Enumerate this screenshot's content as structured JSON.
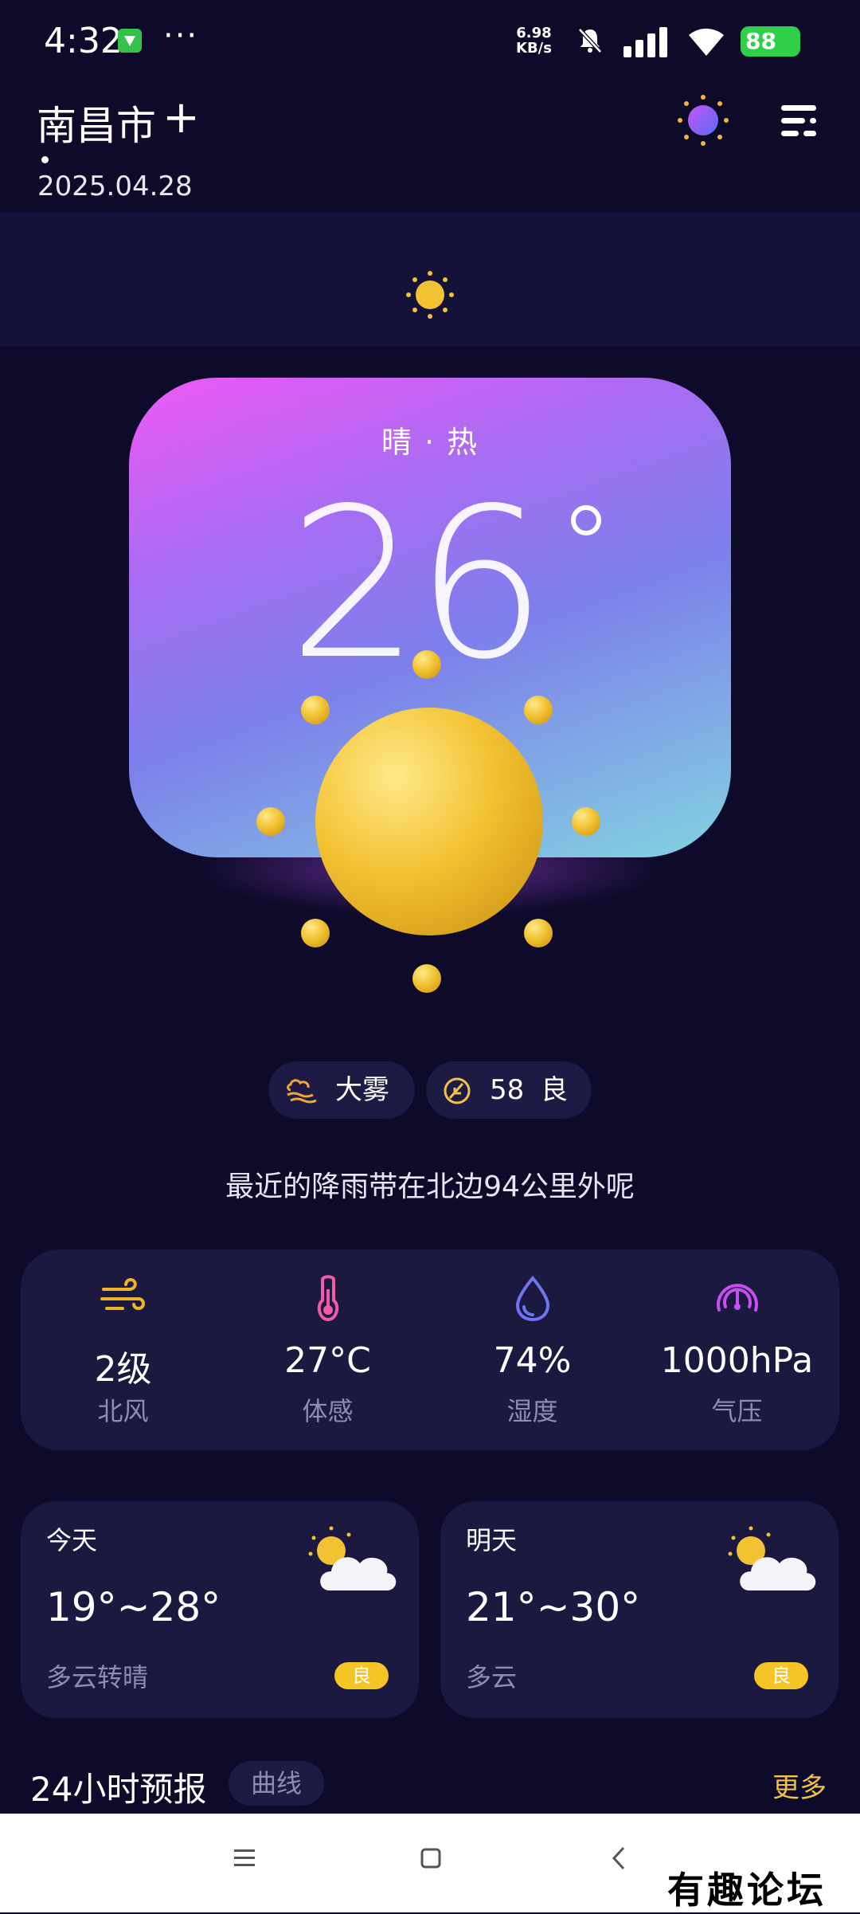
{
  "status_bar": {
    "time": "4:32",
    "more": "···",
    "net_speed_value": "6.98",
    "net_speed_unit": "KB/s",
    "battery": "88"
  },
  "header": {
    "city": "南昌市",
    "add_symbol": "+",
    "date": "2025.04.28"
  },
  "hero": {
    "condition": "晴 · 热",
    "temperature": "26"
  },
  "chips": {
    "weather_tag": "大雾",
    "aqi_value": "58",
    "aqi_level": "良"
  },
  "rain_note": "最近的降雨带在北边94公里外呢",
  "details": [
    {
      "icon": "wind-icon",
      "value": "2级",
      "label": "北风"
    },
    {
      "icon": "thermometer-icon",
      "value": "27°C",
      "label": "体感"
    },
    {
      "icon": "humidity-icon",
      "value": "74%",
      "label": "湿度"
    },
    {
      "icon": "pressure-gauge-icon",
      "value": "1000hPa",
      "label": "气压"
    }
  ],
  "days": [
    {
      "name": "今天",
      "range": "19°~28°",
      "desc": "多云转晴",
      "aqi": "良"
    },
    {
      "name": "明天",
      "range": "21°~30°",
      "desc": "多云",
      "aqi": "良"
    }
  ],
  "forecast": {
    "title": "24小时预报",
    "tab": "曲线",
    "more": "更多"
  },
  "watermark": "有趣论坛",
  "colors": {
    "background": "#0e0b2a",
    "card": "#1b1940",
    "accent_yellow": "#f5c525",
    "wind": "#f0b429",
    "thermometer": "#f05aa6",
    "humidity": "#6f74f2",
    "pressure": "#c54ff0"
  }
}
